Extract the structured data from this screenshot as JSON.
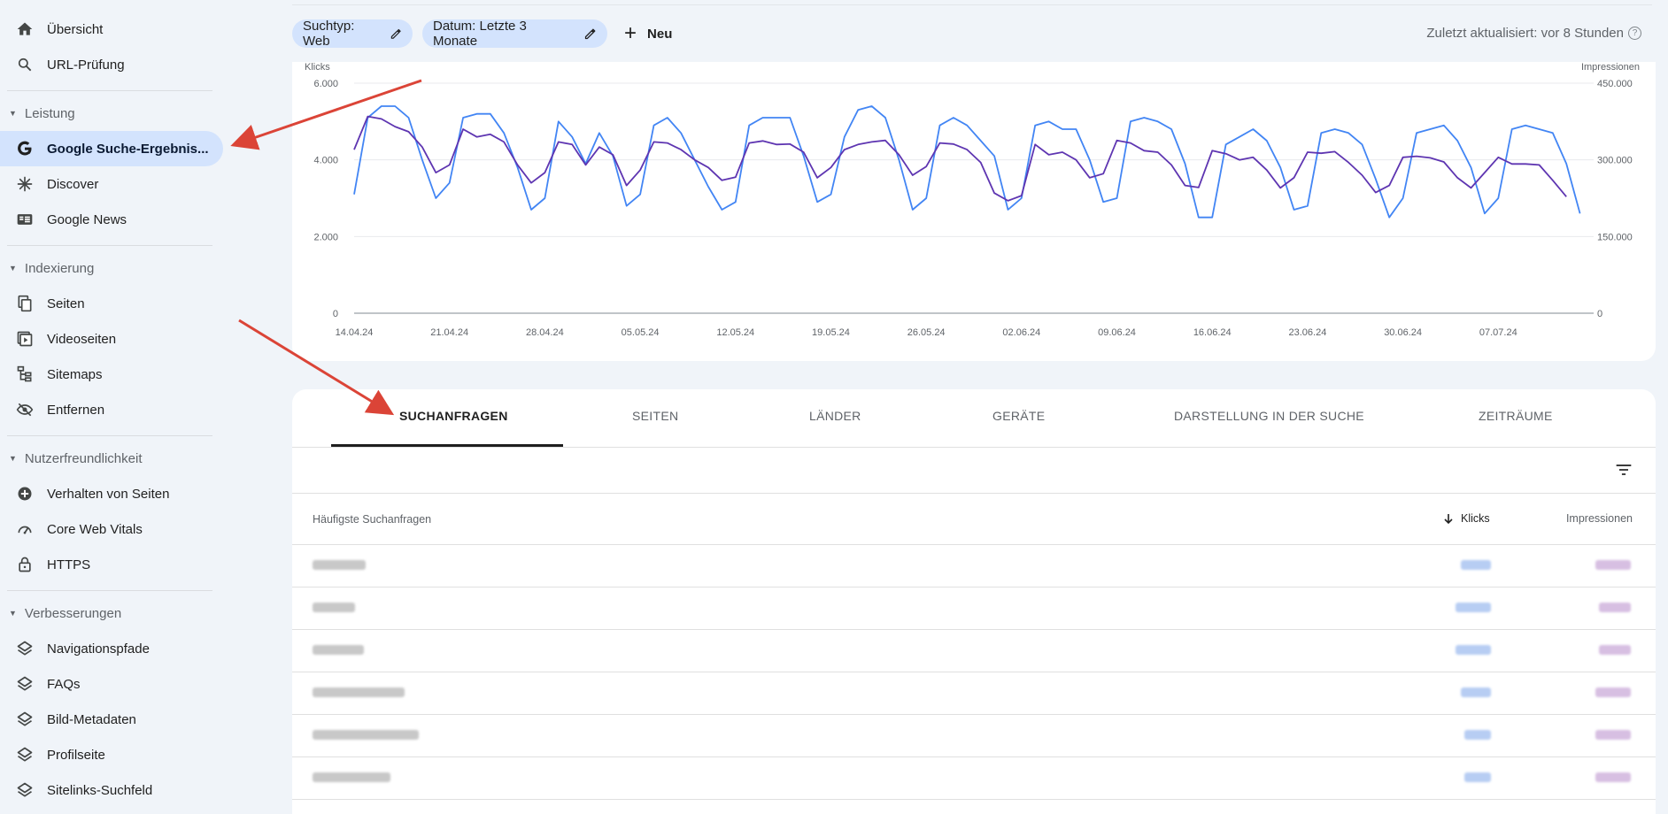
{
  "sidebar": {
    "top_items": [
      {
        "label": "Übersicht",
        "icon": "home-icon"
      },
      {
        "label": "URL-Prüfung",
        "icon": "search-icon"
      }
    ],
    "sections": [
      {
        "title": "Leistung",
        "items": [
          {
            "label": "Google Suche-Ergebnis...",
            "icon": "google-g-icon",
            "active": true
          },
          {
            "label": "Discover",
            "icon": "asterisk-icon"
          },
          {
            "label": "Google News",
            "icon": "news-icon"
          }
        ]
      },
      {
        "title": "Indexierung",
        "items": [
          {
            "label": "Seiten",
            "icon": "pages-icon"
          },
          {
            "label": "Videoseiten",
            "icon": "video-pages-icon"
          },
          {
            "label": "Sitemaps",
            "icon": "sitemap-icon"
          },
          {
            "label": "Entfernen",
            "icon": "eye-off-icon"
          }
        ]
      },
      {
        "title": "Nutzerfreundlichkeit",
        "items": [
          {
            "label": "Verhalten von Seiten",
            "icon": "plus-circle-icon"
          },
          {
            "label": "Core Web Vitals",
            "icon": "gauge-icon"
          },
          {
            "label": "HTTPS",
            "icon": "lock-icon"
          }
        ]
      },
      {
        "title": "Verbesserungen",
        "items": [
          {
            "label": "Navigationspfade",
            "icon": "layers-icon"
          },
          {
            "label": "FAQs",
            "icon": "layers-icon"
          },
          {
            "label": "Bild-Metadaten",
            "icon": "layers-icon"
          },
          {
            "label": "Profilseite",
            "icon": "layers-icon"
          },
          {
            "label": "Sitelinks-Suchfeld",
            "icon": "layers-icon"
          }
        ]
      }
    ]
  },
  "filters": {
    "search_type": "Suchtyp: Web",
    "date": "Datum: Letzte 3 Monate",
    "new_label": "Neu",
    "updated": "Zuletzt aktualisiert: vor 8 Stunden"
  },
  "chart_data": {
    "type": "line",
    "y_left_label": "Klicks",
    "y_right_label": "Impressionen",
    "y_left_ticks": [
      "0",
      "2.000",
      "4.000",
      "6.000"
    ],
    "y_right_ticks": [
      "0",
      "150.000",
      "300.000",
      "450.000"
    ],
    "ylim_left": [
      0,
      6000
    ],
    "ylim_right": [
      0,
      450000
    ],
    "x_tick_labels": [
      "14.04.24",
      "21.04.24",
      "28.04.24",
      "05.05.24",
      "12.05.24",
      "19.05.24",
      "26.05.24",
      "02.06.24",
      "09.06.24",
      "16.06.24",
      "23.06.24",
      "30.06.24",
      "07.07.24"
    ],
    "x_days": 92,
    "grid": true,
    "series": [
      {
        "name": "Klicks",
        "axis": "left",
        "color": "#4285f4",
        "values": [
          3100,
          5100,
          5400,
          5400,
          5100,
          4000,
          3000,
          3400,
          5100,
          5200,
          5200,
          4700,
          3800,
          2700,
          3000,
          5000,
          4600,
          3900,
          4700,
          4100,
          2800,
          3100,
          4900,
          5100,
          4700,
          4000,
          3300,
          2700,
          2900,
          4900,
          5100,
          5100,
          5100,
          4100,
          2900,
          3100,
          4600,
          5300,
          5400,
          5100,
          4000,
          2700,
          3000,
          4900,
          5100,
          4900,
          4500,
          4100,
          2700,
          3000,
          4900,
          5000,
          4800,
          4800,
          4000,
          2900,
          3000,
          5000,
          5100,
          5000,
          4800,
          3900,
          2500,
          2500,
          4400,
          4600,
          4800,
          4500,
          3800,
          2700,
          2800,
          4700,
          4800,
          4700,
          4400,
          3500,
          2500,
          3000,
          4700,
          4800,
          4900,
          4500,
          3800,
          2600,
          3000,
          4800,
          4900,
          4800,
          4700,
          3900,
          2600
        ]
      },
      {
        "name": "Impressionen",
        "axis": "right",
        "color": "#5e35b1",
        "values": [
          320000,
          385000,
          380000,
          365000,
          355000,
          325000,
          275000,
          290000,
          360000,
          345000,
          350000,
          335000,
          290000,
          255000,
          275000,
          335000,
          330000,
          290000,
          325000,
          310000,
          250000,
          280000,
          335000,
          333000,
          320000,
          300000,
          285000,
          260000,
          266000,
          333000,
          337000,
          330000,
          331000,
          315000,
          265000,
          285000,
          320000,
          330000,
          335000,
          338000,
          310000,
          270000,
          287000,
          333000,
          331000,
          320000,
          295000,
          235000,
          220000,
          230000,
          330000,
          310000,
          315000,
          300000,
          265000,
          273000,
          338000,
          333000,
          318000,
          315000,
          290000,
          250000,
          246000,
          318000,
          312000,
          300000,
          305000,
          280000,
          245000,
          265000,
          315000,
          313000,
          316000,
          295000,
          270000,
          236000,
          250000,
          305000,
          307000,
          304000,
          296000,
          265000,
          245000,
          275000,
          305000,
          292000,
          292000,
          290000,
          260000,
          228000
        ]
      }
    ]
  },
  "tabs": [
    {
      "label": "SUCHANFRAGEN",
      "active": true
    },
    {
      "label": "SEITEN",
      "active": false
    },
    {
      "label": "LÄNDER",
      "active": false
    },
    {
      "label": "GERÄTE",
      "active": false
    },
    {
      "label": "DARSTELLUNG IN DER SUCHE",
      "active": false
    },
    {
      "label": "ZEITRÄUME",
      "active": false
    }
  ],
  "table": {
    "col_query": "Häufigste Suchanfragen",
    "col_clicks": "Klicks",
    "col_impressions": "Impressionen",
    "rows": [
      {
        "query": "",
        "clicks": "",
        "impressions": ""
      },
      {
        "query": "",
        "clicks": "",
        "impressions": ""
      },
      {
        "query": "",
        "clicks": "",
        "impressions": ""
      },
      {
        "query": "",
        "clicks": "",
        "impressions": ""
      },
      {
        "query": "",
        "clicks": "",
        "impressions": ""
      },
      {
        "query": "",
        "clicks": "",
        "impressions": ""
      }
    ]
  },
  "colors": {
    "accent_chip": "#d3e3fd",
    "annotation_arrow": "#db4437"
  }
}
